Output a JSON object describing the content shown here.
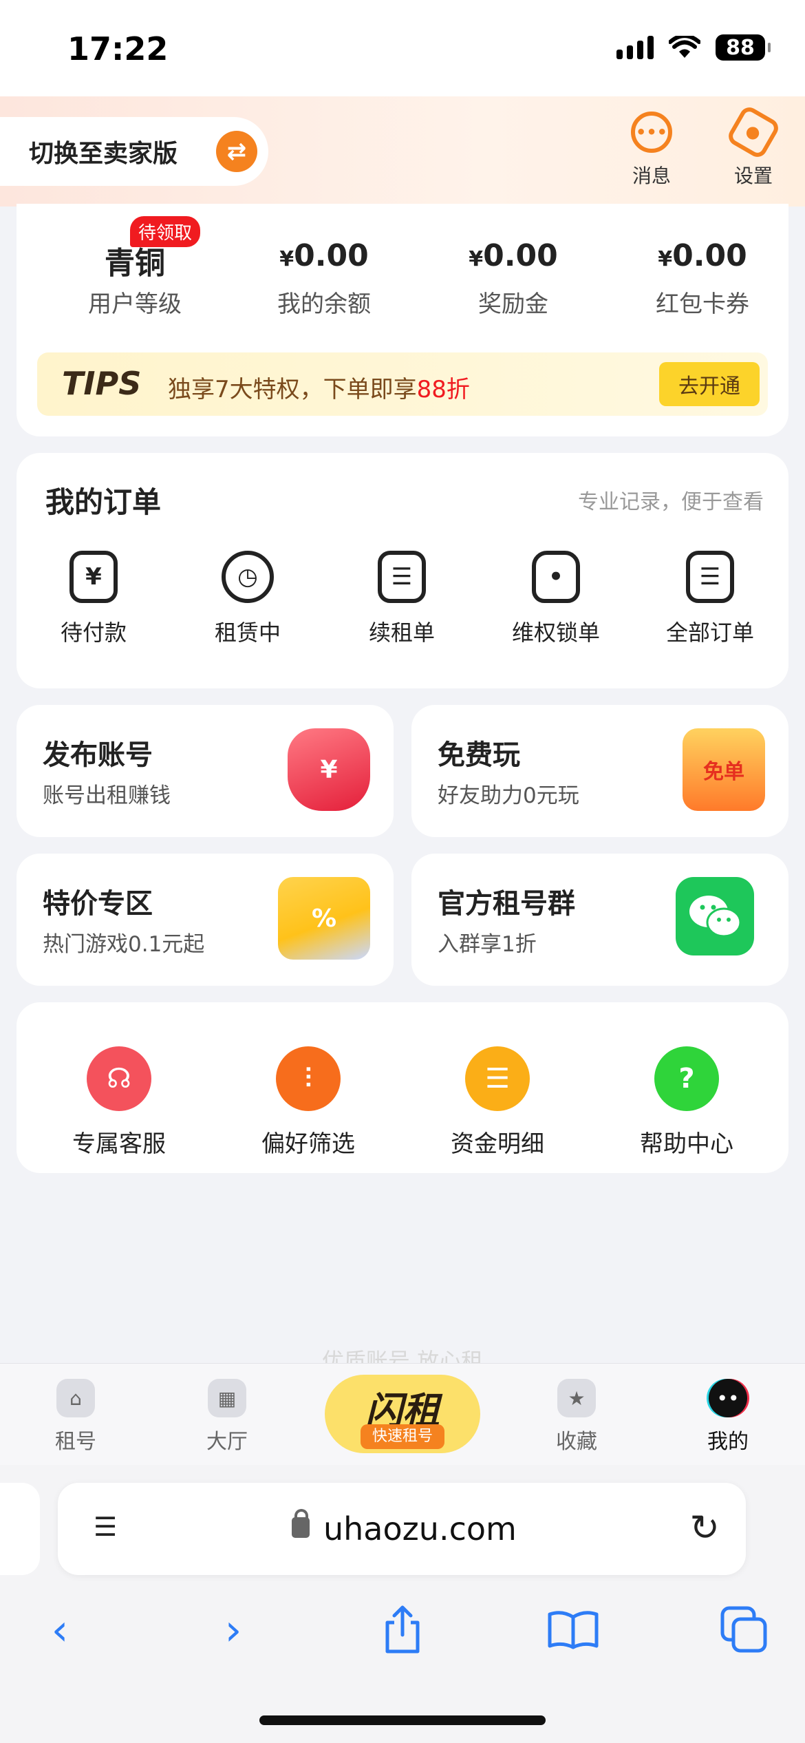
{
  "status_bar": {
    "time": "17:22",
    "battery": "88"
  },
  "header": {
    "switch_label": "切换至卖家版",
    "switch_icon": "swap-icon",
    "messages_label": "消息",
    "settings_label": "设置"
  },
  "stats": {
    "badge": "待领取",
    "items": [
      {
        "value": "青铜",
        "label": "用户等级"
      },
      {
        "currency": "¥",
        "value": "0.00",
        "label": "我的余额"
      },
      {
        "currency": "¥",
        "value": "0.00",
        "label": "奖励金"
      },
      {
        "currency": "¥",
        "value": "0.00",
        "label": "红包卡券"
      }
    ]
  },
  "tips": {
    "logo": "TIPS",
    "text": "独享7大特权，下单即享",
    "highlight": "88折",
    "button": "去开通"
  },
  "orders": {
    "title": "我的订单",
    "subtitle": "专业记录，便于查看",
    "items": [
      {
        "label": "待付款",
        "icon": "yen-icon"
      },
      {
        "label": "租赁中",
        "icon": "clock-icon"
      },
      {
        "label": "续租单",
        "icon": "clipboard-icon"
      },
      {
        "label": "维权锁单",
        "icon": "lock-icon"
      },
      {
        "label": "全部订单",
        "icon": "orders-stack-icon"
      }
    ]
  },
  "promos": [
    {
      "title": "发布账号",
      "subtitle": "账号出租赚钱",
      "icon": "red-envelope-icon"
    },
    {
      "title": "免费玩",
      "subtitle": "好友助力0元玩",
      "icon": "free-envelope-icon",
      "icon_text": "免单"
    },
    {
      "title": "特价专区",
      "subtitle": "热门游戏0.1元起",
      "icon": "discount-ticket-icon"
    },
    {
      "title": "官方租号群",
      "subtitle": "入群享1折",
      "icon": "wechat-icon"
    }
  ],
  "tools": [
    {
      "label": "专属客服",
      "icon": "headset-icon",
      "color": "#f4525c"
    },
    {
      "label": "偏好筛选",
      "icon": "filter-icon",
      "color": "#f76d1c"
    },
    {
      "label": "资金明细",
      "icon": "ledger-icon",
      "color": "#fbae17"
    },
    {
      "label": "帮助中心",
      "icon": "help-icon",
      "color": "#2fd43a"
    }
  ],
  "faded_slogan": "优质账号 放心租",
  "tabbar": {
    "tabs": [
      {
        "label": "租号",
        "icon": "home-icon"
      },
      {
        "label": "大厅",
        "icon": "grid-icon"
      },
      {
        "label": "收藏",
        "icon": "star-icon"
      },
      {
        "label": "我的",
        "icon": "profile-face-icon"
      }
    ],
    "center_main": "闪租",
    "center_sub": "快速租号"
  },
  "browser": {
    "url": "uhaozu.com"
  }
}
